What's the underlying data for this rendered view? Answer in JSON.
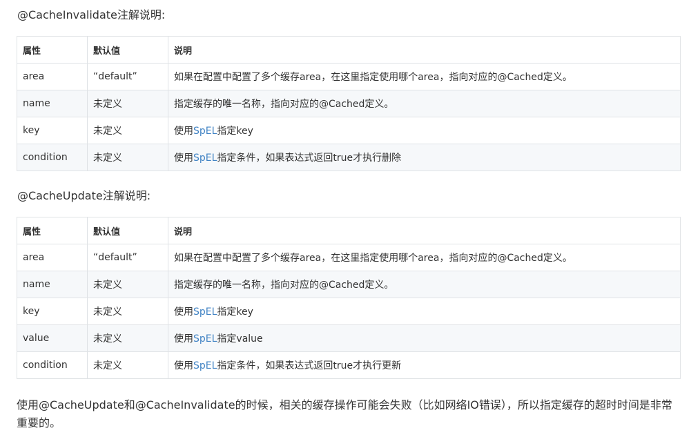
{
  "section1": {
    "heading": "@CacheInvalidate注解说明:",
    "headers": [
      "属性",
      "默认值",
      "说明"
    ],
    "rows": [
      {
        "attr": "area",
        "default": "“default”",
        "desc_before": "如果在配置中配置了多个缓存area，在这里指定使用哪个area，指向对应的@Cached定义。",
        "link": "",
        "desc_after": ""
      },
      {
        "attr": "name",
        "default": "未定义",
        "desc_before": "指定缓存的唯一名称，指向对应的@Cached定义。",
        "link": "",
        "desc_after": ""
      },
      {
        "attr": "key",
        "default": "未定义",
        "desc_before": "使用",
        "link": "SpEL",
        "desc_after": "指定key"
      },
      {
        "attr": "condition",
        "default": "未定义",
        "desc_before": "使用",
        "link": "SpEL",
        "desc_after": "指定条件，如果表达式返回true才执行删除"
      }
    ]
  },
  "section2": {
    "heading": "@CacheUpdate注解说明:",
    "headers": [
      "属性",
      "默认值",
      "说明"
    ],
    "rows": [
      {
        "attr": "area",
        "default": "“default”",
        "desc_before": "如果在配置中配置了多个缓存area，在这里指定使用哪个area，指向对应的@Cached定义。",
        "link": "",
        "desc_after": ""
      },
      {
        "attr": "name",
        "default": "未定义",
        "desc_before": "指定缓存的唯一名称，指向对应的@Cached定义。",
        "link": "",
        "desc_after": ""
      },
      {
        "attr": "key",
        "default": "未定义",
        "desc_before": "使用",
        "link": "SpEL",
        "desc_after": "指定key"
      },
      {
        "attr": "value",
        "default": "未定义",
        "desc_before": "使用",
        "link": "SpEL",
        "desc_after": "指定value"
      },
      {
        "attr": "condition",
        "default": "未定义",
        "desc_before": "使用",
        "link": "SpEL",
        "desc_after": "指定条件，如果表达式返回true才执行更新"
      }
    ]
  },
  "footer": {
    "text": "使用@CacheUpdate和@CacheInvalidate的时候，相关的缓存操作可能会失败（比如网络IO错误），所以指定缓存的超时时间是非常重要的。"
  },
  "colors": {
    "text": "#333333",
    "link": "#4183c4",
    "border": "#dfe2e5",
    "stripe": "#f6f8fa"
  }
}
